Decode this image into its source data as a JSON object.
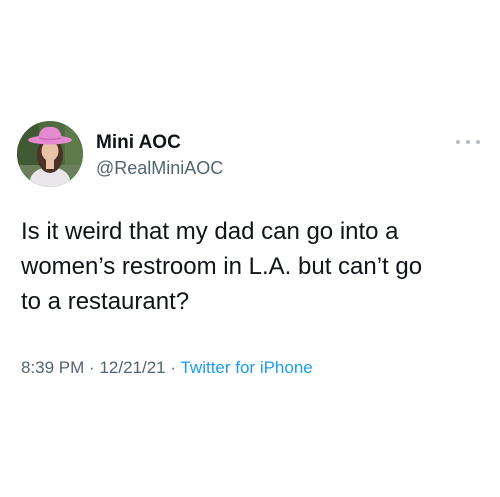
{
  "tweet": {
    "display_name": "Mini AOC",
    "handle": "@RealMiniAOC",
    "text_lines": [
      "Is it weird that my dad can go into a",
      "women’s restroom in L.A. but can’t go",
      "to a restaurant?"
    ],
    "time": "8:39 PM",
    "date": "12/21/21",
    "separator": "·",
    "source": "Twitter for iPhone",
    "more_menu_icon": "more-dots-icon"
  },
  "colors": {
    "text": "#0f1419",
    "secondary": "#536471",
    "link": "#1d9bf0",
    "hat": "#e58ad0"
  }
}
